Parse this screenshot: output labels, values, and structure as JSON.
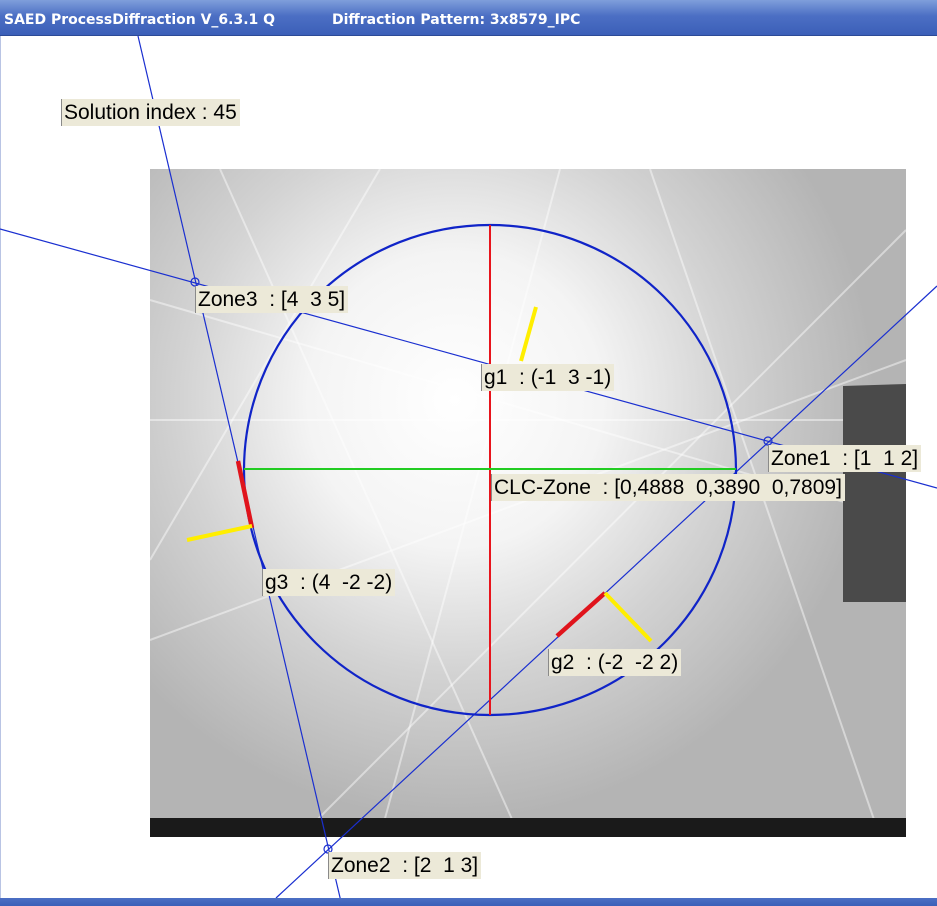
{
  "window": {
    "app_title": "SAED ProcessDiffraction V_6.3.1 Q",
    "document_title": "Diffraction Pattern: 3x8579_IPC"
  },
  "labels": {
    "solution": "Solution index : 45",
    "zone1": "Zone1  : [1  1 2]",
    "zone2": "Zone2  : [2  1 3]",
    "zone3": "Zone3  : [4  3 5]",
    "g1": "g1  : (-1  3 -1)",
    "g2": "g2  : (-2  -2 2)",
    "g3": "g3  : (4  -2 -2)",
    "clc": "CLC-Zone  : [0,4888  0,3890  0,7809]"
  },
  "colors": {
    "zone_lines": "#1a2fd0",
    "circle": "#1024c8",
    "radius_vertical": "#e8141c",
    "radius_horizontal": "#22cc22",
    "g_vector_red": "#e0141c",
    "g_vector_yellow": "#ffee00",
    "label_background": "#ece9d8"
  }
}
